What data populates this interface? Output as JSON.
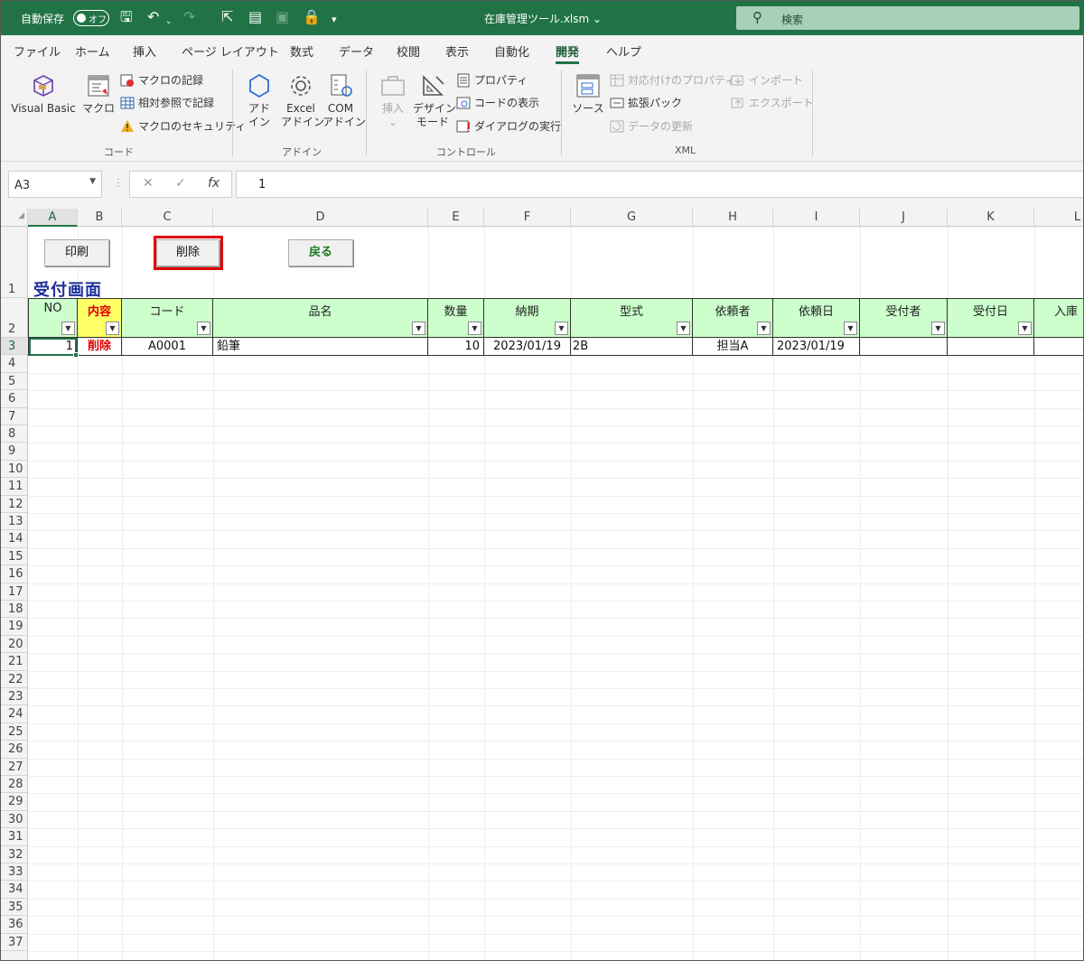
{
  "titlebar": {
    "autosave_label": "自動保存",
    "autosave_state": "オフ",
    "filename": "在庫管理ツール.xlsm",
    "search_placeholder": "検索",
    "accent": "#217346"
  },
  "ribbon": {
    "tabs": [
      "ファイル",
      "ホーム",
      "挿入",
      "ページ レイアウト",
      "数式",
      "データ",
      "校閲",
      "表示",
      "自動化",
      "開発",
      "ヘルプ"
    ],
    "active_tab": "開発",
    "code_group": {
      "label": "コード",
      "visual_basic": "Visual Basic",
      "macro": "マクロ",
      "record_macro": "マクロの記録",
      "relative_ref": "相対参照で記録",
      "macro_security": "マクロのセキュリティ"
    },
    "addin_group": {
      "label": "アドイン",
      "addin_1": "アド",
      "addin_2": "イン",
      "excel_addin_1": "Excel",
      "excel_addin_2": "アドイン",
      "com_addin_1": "COM",
      "com_addin_2": "アドイン"
    },
    "control_group": {
      "label": "コントロール",
      "insert": "挿入",
      "design_mode_1": "デザイン",
      "design_mode_2": "モード",
      "properties": "プロパティ",
      "view_code": "コードの表示",
      "run_dialog": "ダイアログの実行"
    },
    "xml_group": {
      "label": "XML",
      "source": "ソース",
      "map_properties": "対応付けのプロパティ",
      "expansion_packs": "拡張パック",
      "refresh_data": "データの更新",
      "import": "インポート",
      "export": "エクスポート"
    }
  },
  "formula_bar": {
    "name_box": "A3",
    "cancel": "✕",
    "enter": "✓",
    "fx": "fx",
    "content": "1"
  },
  "sheet": {
    "columns": [
      "A",
      "B",
      "C",
      "D",
      "E",
      "F",
      "G",
      "H",
      "I",
      "J",
      "K",
      "L"
    ],
    "rows": [
      "1",
      "2",
      "3",
      "4",
      "5",
      "6",
      "7",
      "8",
      "9",
      "10",
      "11",
      "12",
      "13",
      "14",
      "15",
      "16",
      "17",
      "18",
      "19",
      "20",
      "21",
      "22",
      "23",
      "24",
      "25",
      "26",
      "27",
      "28",
      "29",
      "30",
      "31",
      "32",
      "33",
      "34",
      "35",
      "36",
      "37"
    ],
    "buttons": {
      "print": "印刷",
      "delete": "削除",
      "back": "戻る"
    },
    "title": "受付画面",
    "headers": [
      "NO",
      "内容",
      "コード",
      "品名",
      "数量",
      "納期",
      "型式",
      "依頼者",
      "依頼日",
      "受付者",
      "受付日",
      "入庫"
    ],
    "row3": [
      "1",
      "削除",
      "A0001",
      "鉛筆",
      "10",
      "2023/01/19",
      "2B",
      "担当A",
      "2023/01/19",
      "",
      "",
      ""
    ],
    "header_fill": "#ccffcc",
    "highlight_fill": "#ffff66",
    "highlight_border": "#e00000"
  }
}
